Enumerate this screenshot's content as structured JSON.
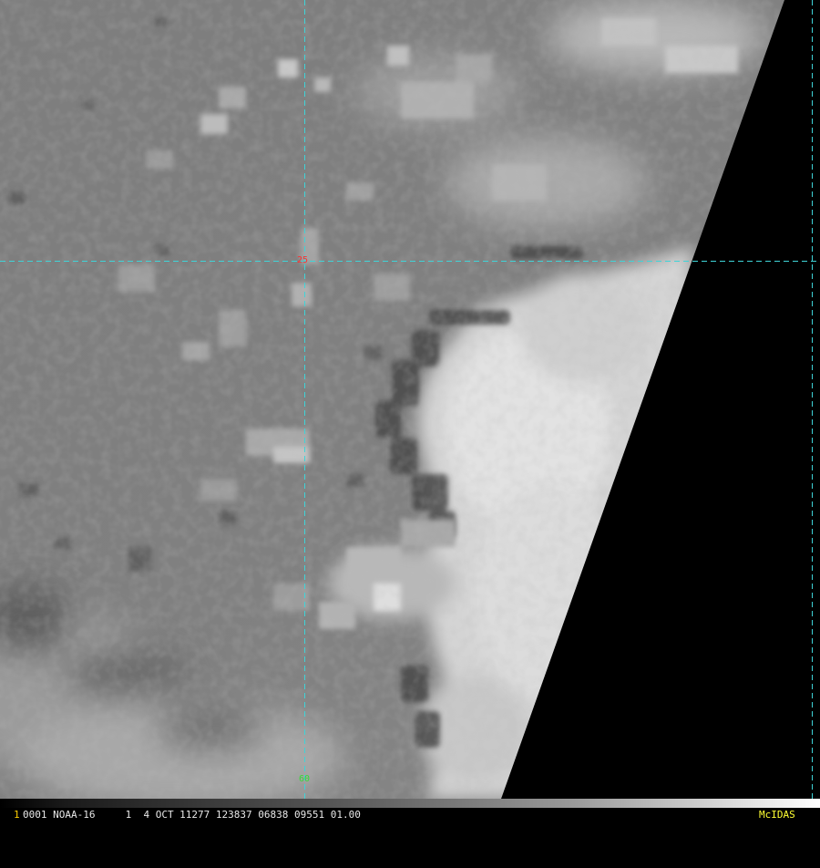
{
  "overlay": {
    "latitude_label": "25",
    "longitude_label": "60",
    "grid_color": "#3fd4d8",
    "latitude_label_color": "#ff3030",
    "longitude_label_color": "#33dd33"
  },
  "imagery": {
    "type": "grayscale satellite infrared image",
    "ocean_tone": "#808080",
    "cloud_tone": "#e0e0e0",
    "no_data_color": "#000000"
  },
  "status_bar": {
    "frame_number": "1",
    "image_info": "0001 NOAA-16     1  4 OCT 11277 123837 06838 09551 01.00",
    "software_label": "McIDAS",
    "frame_color": "#ffd000",
    "software_color": "#ffff33",
    "text_color": "#e8e8e8"
  }
}
